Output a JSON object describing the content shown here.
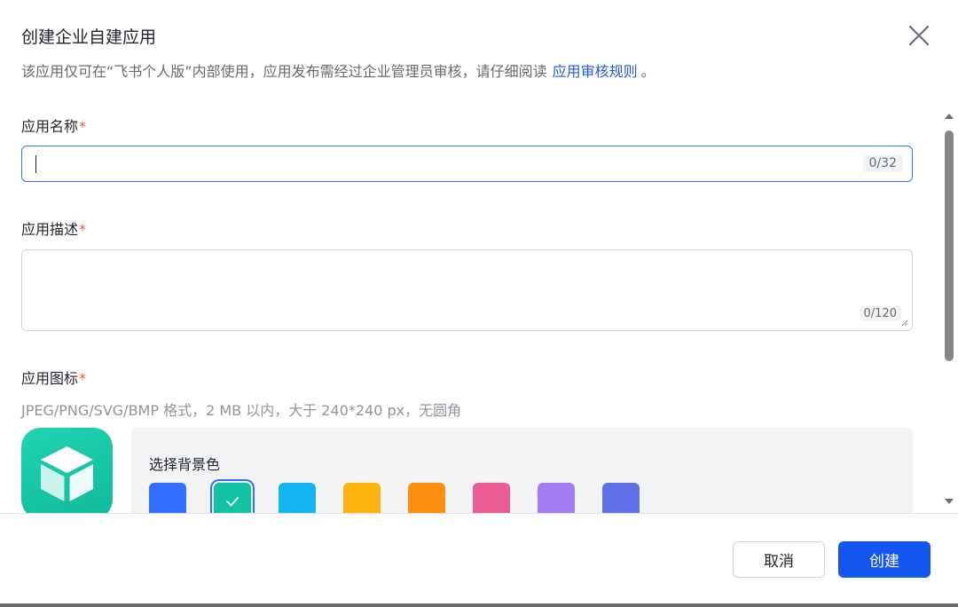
{
  "dialog": {
    "title": "创建企业自建应用",
    "subtitle_text": "该应用仅可在“飞书个人版”内部使用，应用发布需经过企业管理员审核，请仔细阅读",
    "subtitle_link": "应用审核规则",
    "subtitle_end": "。"
  },
  "form": {
    "name": {
      "label": "应用名称",
      "required_mark": "*",
      "value": "",
      "counter": "0/32"
    },
    "description": {
      "label": "应用描述",
      "required_mark": "*",
      "value": "",
      "counter": "0/120"
    },
    "icon": {
      "label": "应用图标",
      "required_mark": "*",
      "hint": "JPEG/PNG/SVG/BMP 格式，2 MB 以内，大于 240*240 px，无圆角",
      "icon_name": "cube-icon",
      "bg_panel_title": "选择背景色",
      "swatches": [
        {
          "color": "#3370ff",
          "selected": false
        },
        {
          "color": "#13c2a4",
          "selected": true
        },
        {
          "color": "#12b5f0",
          "selected": false
        },
        {
          "color": "#ffb30f",
          "selected": false
        },
        {
          "color": "#ff8f0f",
          "selected": false
        },
        {
          "color": "#ec5d93",
          "selected": false
        },
        {
          "color": "#a27cf2",
          "selected": false
        },
        {
          "color": "#6170e6",
          "selected": false
        }
      ]
    }
  },
  "footer": {
    "cancel_label": "取消",
    "create_label": "创建"
  },
  "colors": {
    "accent": "#3370ff",
    "primary_button": "#1456f0",
    "required": "#f54a45",
    "link": "#245bdb"
  }
}
